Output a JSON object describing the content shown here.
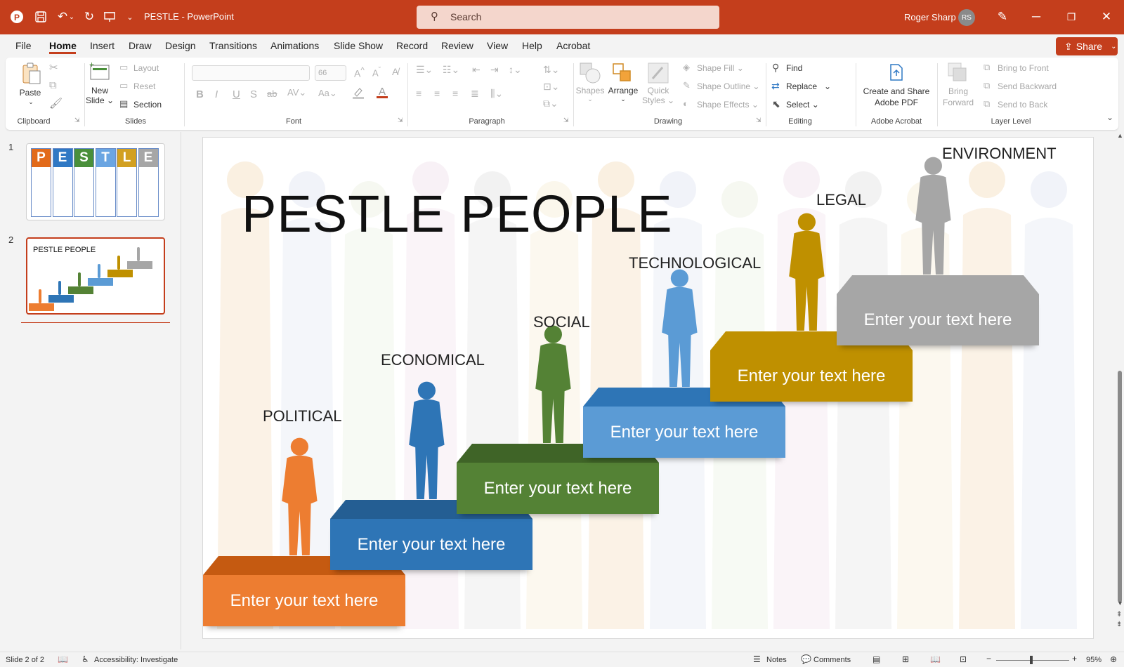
{
  "app": {
    "doc_title": "PESTLE  -  PowerPoint",
    "user_name": "Roger Sharp",
    "user_initials": "RS"
  },
  "search": {
    "placeholder": "Search"
  },
  "tabs": [
    "File",
    "Home",
    "Insert",
    "Draw",
    "Design",
    "Transitions",
    "Animations",
    "Slide Show",
    "Record",
    "Review",
    "View",
    "Help",
    "Acrobat"
  ],
  "share_label": "Share",
  "ribbon": {
    "clipboard": {
      "paste": "Paste",
      "group": "Clipboard"
    },
    "slides": {
      "new_slide_1": "New",
      "new_slide_2": "Slide",
      "layout": "Layout",
      "reset": "Reset",
      "section": "Section",
      "group": "Slides"
    },
    "font": {
      "font_size": "66",
      "bold": "B",
      "italic": "I",
      "underline": "U",
      "shadow": "S",
      "strike": "ab",
      "group": "Font"
    },
    "paragraph": {
      "group": "Paragraph"
    },
    "drawing": {
      "shapes": "Shapes",
      "arrange": "Arrange",
      "quick_styles_1": "Quick",
      "quick_styles_2": "Styles",
      "shape_fill": "Shape Fill",
      "shape_outline": "Shape Outline",
      "shape_effects": "Shape Effects",
      "group": "Drawing"
    },
    "editing": {
      "find": "Find",
      "replace": "Replace",
      "select": "Select",
      "group": "Editing"
    },
    "acrobat": {
      "create_1": "Create and Share",
      "create_2": "Adobe PDF",
      "group": "Adobe Acrobat"
    },
    "layer": {
      "bring_forward_1": "Bring",
      "bring_forward_2": "Forward",
      "bring_front": "Bring to Front",
      "send_backward": "Send Backward",
      "send_back": "Send to Back",
      "group": "Layer Level"
    }
  },
  "thumbnails": {
    "numbers": [
      "1",
      "2"
    ],
    "slide1_letters": [
      "P",
      "E",
      "S",
      "T",
      "L",
      "E"
    ],
    "slide1_colors": [
      "#e26a1a",
      "#2f78c4",
      "#4a8f3a",
      "#6aa5e2",
      "#d2a021",
      "#a6a6a6"
    ],
    "slide2_title": "PESTLE PEOPLE"
  },
  "slide": {
    "title": "PESTLE PEOPLE",
    "categories": [
      {
        "label": "POLITICAL",
        "text": "Enter your text here",
        "color": "#ed7d31",
        "top_color": "#c55a11"
      },
      {
        "label": "ECONOMICAL",
        "text": "Enter your text here",
        "color": "#2e75b6",
        "top_color": "#245e93"
      },
      {
        "label": "SOCIAL",
        "text": "Enter your text here",
        "color": "#548235",
        "top_color": "#3f6427"
      },
      {
        "label": "TECHNOLOGICAL",
        "text": "Enter your text here",
        "color": "#5b9bd5",
        "top_color": "#2e75b6"
      },
      {
        "label": "LEGAL",
        "text": "Enter your text here",
        "color": "#bf9000",
        "top_color": "#bf9000"
      },
      {
        "label": "ENVIRONMENT",
        "text": "Enter your text here",
        "color": "#a6a6a6",
        "top_color": "#a6a6a6"
      }
    ]
  },
  "status": {
    "slide_of": "Slide 2 of 2",
    "accessibility": "Accessibility: Investigate",
    "notes": "Notes",
    "comments": "Comments",
    "zoom": "95%"
  }
}
